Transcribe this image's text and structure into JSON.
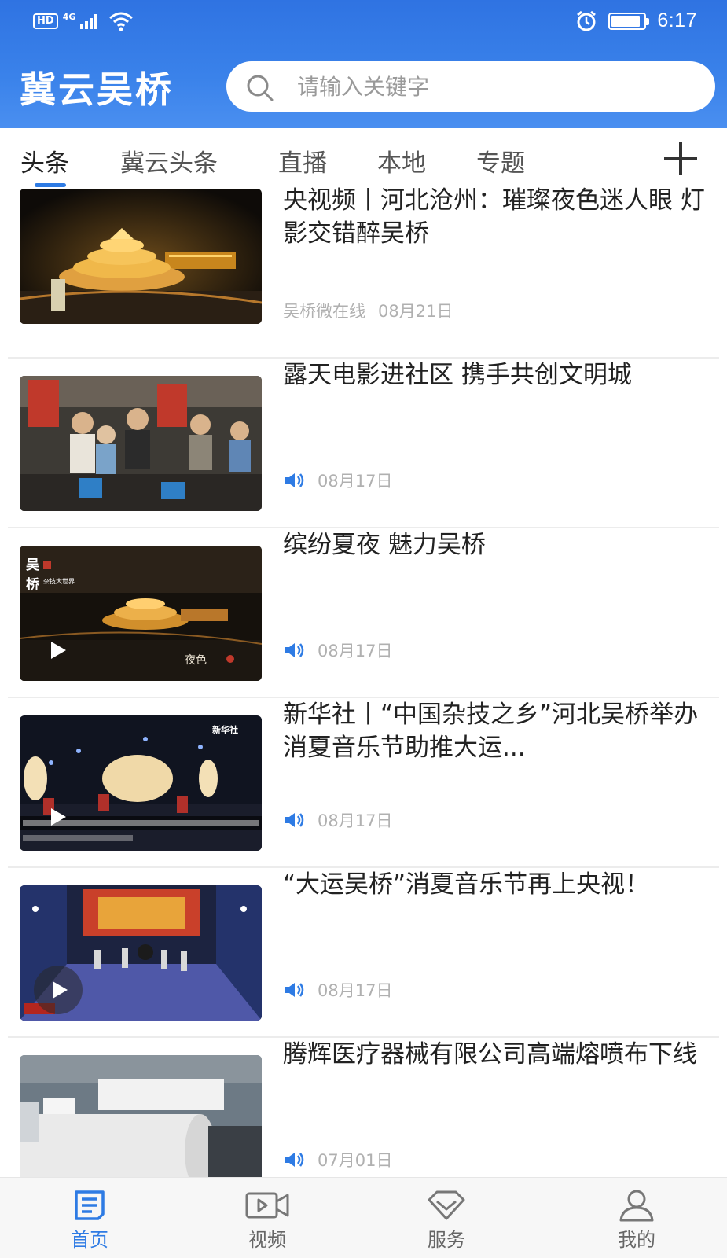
{
  "status_bar": {
    "hd": "HD",
    "network": "4G",
    "time": "6:17"
  },
  "app": {
    "title": "冀云吴桥",
    "search_placeholder": "请输入关键字"
  },
  "tabs": [
    {
      "label": "头条",
      "active": true
    },
    {
      "label": "冀云头条",
      "active": false
    },
    {
      "label": "直播",
      "active": false
    },
    {
      "label": "本地",
      "active": false
    },
    {
      "label": "专题",
      "active": false
    }
  ],
  "news": [
    {
      "title": "央视频丨河北沧州：璀璨夜色迷人眼 灯影交错醉吴桥",
      "source": "吴桥微在线",
      "date": "08月21日",
      "audio": false,
      "video": false
    },
    {
      "title": "露天电影进社区 携手共创文明城",
      "source": "",
      "date": "08月17日",
      "audio": true,
      "video": false
    },
    {
      "title": "缤纷夏夜 魅力吴桥",
      "source": "",
      "date": "08月17日",
      "audio": true,
      "video": true
    },
    {
      "title": "新华社丨“中国杂技之乡”河北吴桥举办消夏音乐节助推大运...",
      "source": "",
      "date": "08月17日",
      "audio": true,
      "video": true
    },
    {
      "title": "“大运吴桥”消夏音乐节再上央视！",
      "source": "",
      "date": "08月17日",
      "audio": true,
      "video": true
    },
    {
      "title": "腾辉医疗器械有限公司高端熔喷布下线",
      "source": "",
      "date": "07月01日",
      "audio": true,
      "video": false
    }
  ],
  "bottom_nav": [
    {
      "label": "首页",
      "icon": "home-news-icon",
      "active": true
    },
    {
      "label": "视频",
      "icon": "video-camera-icon",
      "active": false
    },
    {
      "label": "服务",
      "icon": "service-diamond-icon",
      "active": false
    },
    {
      "label": "我的",
      "icon": "user-profile-icon",
      "active": false
    }
  ],
  "colors": {
    "header": "#3a82ea",
    "accent": "#2e7be4"
  }
}
